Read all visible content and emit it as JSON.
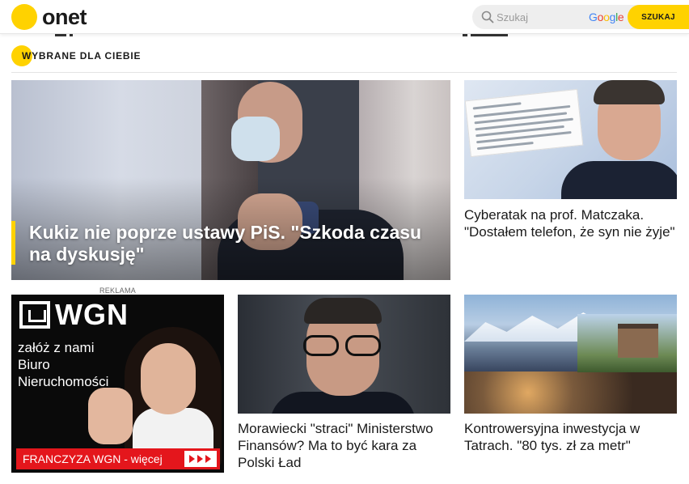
{
  "header": {
    "logo_text": "onet",
    "search_placeholder": "Szukaj",
    "google_label": "Google",
    "search_button": "SZUKAJ"
  },
  "section": {
    "title": "WYBRANE DLA CIEBIE"
  },
  "hero": {
    "title": "Kukiz nie poprze ustawy PiS. \"Szkoda czasu na dyskusję\""
  },
  "articles": [
    {
      "title": "Cyberatak na prof. Matczaka. \"Dostałem telefon, że syn nie żyje\""
    },
    {
      "title": "Morawiecki \"straci\" Ministerstwo Finansów? Ma to być kara za Polski Ład"
    },
    {
      "title": "Kontrowersyjna inwestycja w Tatrach. \"80 tys. zł za metr\""
    }
  ],
  "ad": {
    "label": "REKLAMA",
    "brand": "WGN",
    "lines": [
      "załóż z nami",
      "Biuro",
      "Nieruchomości"
    ],
    "cta": "FRANCZYZA WGN  -  więcej"
  },
  "colors": {
    "brand_yellow": "#ffd200",
    "ad_red": "#e4161c"
  },
  "icons": {
    "search": "magnifier-icon",
    "logo": "onet-dot-logo"
  }
}
